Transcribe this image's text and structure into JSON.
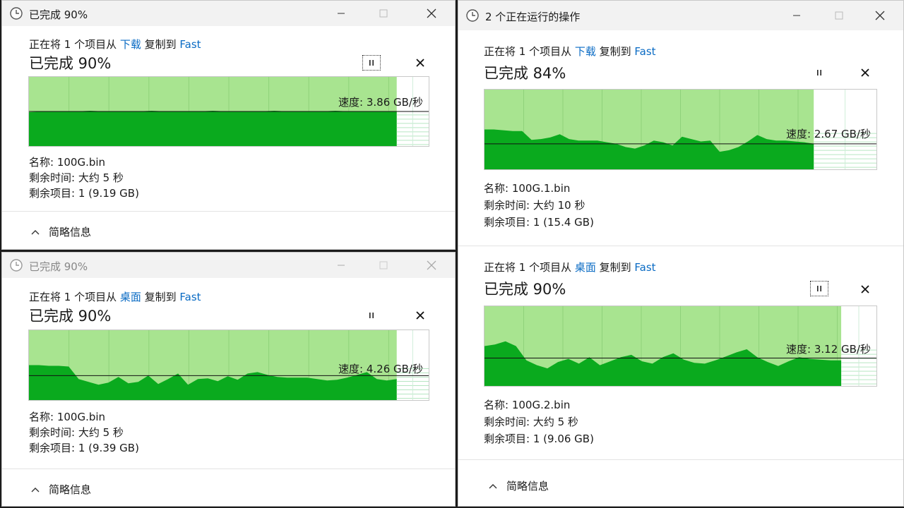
{
  "colors": {
    "graph_fill_light": "#a8e490",
    "graph_fill_dark": "#0aaa1e",
    "link": "#0a6bc4"
  },
  "icons": {
    "clock": "clock-icon",
    "minimize": "minimize-icon",
    "maximize": "maximize-icon",
    "close": "close-icon",
    "pause": "pause-icon",
    "cancel": "cancel-icon",
    "chevron_up": "chevron-up-icon"
  },
  "windows": [
    {
      "title": "已完成 90%",
      "active": true,
      "ops": [
        {
          "line": {
            "prefix": "正在将 1 个项目从 ",
            "source": "下载",
            "middle": " 复制到 ",
            "dest": "Fast"
          },
          "percent_text": "已完成 90%",
          "progress": 0.92,
          "speed_text": "速度: 3.86 GB/秒",
          "speed_level": 0.5,
          "name_label": "名称:",
          "name_value": "100G.bin",
          "time_label": "剩余时间:",
          "time_value": "大约 5 秒",
          "items_label": "剩余项目:",
          "items_value": "1 (9.19 GB)",
          "pause_focused": true,
          "history": [
            0.49,
            0.5,
            0.5,
            0.5,
            0.51,
            0.5,
            0.5,
            0.5,
            0.51,
            0.5,
            0.5,
            0.5,
            0.51,
            0.5,
            0.5,
            0.5,
            0.51,
            0.5,
            0.5,
            0.5,
            0.51,
            0.5,
            0.5,
            0.5,
            0.5
          ]
        }
      ],
      "footer": "简略信息"
    },
    {
      "title": "已完成 90%",
      "active": false,
      "ops": [
        {
          "line": {
            "prefix": "正在将 1 个项目从 ",
            "source": "桌面",
            "middle": " 复制到 ",
            "dest": "Fast"
          },
          "percent_text": "已完成 90%",
          "progress": 0.92,
          "speed_text": "速度: 4.26 GB/秒",
          "speed_level": 0.35,
          "name_label": "名称:",
          "name_value": "100G.bin",
          "time_label": "剩余时间:",
          "time_value": "大约 5 秒",
          "items_label": "剩余项目:",
          "items_value": "1 (9.39 GB)",
          "pause_focused": false,
          "history": [
            0.5,
            0.5,
            0.49,
            0.49,
            0.48,
            0.3,
            0.26,
            0.22,
            0.25,
            0.33,
            0.24,
            0.26,
            0.35,
            0.23,
            0.3,
            0.38,
            0.22,
            0.3,
            0.31,
            0.27,
            0.34,
            0.29,
            0.38,
            0.4,
            0.36,
            0.33,
            0.32,
            0.32,
            0.32,
            0.3,
            0.28,
            0.29,
            0.32,
            0.36,
            0.4,
            0.3,
            0.28,
            0.3
          ]
        }
      ],
      "footer": "简略信息"
    },
    {
      "title": "2 个正在运行的操作",
      "active": true,
      "ops": [
        {
          "line": {
            "prefix": "正在将 1 个项目从 ",
            "source": "下载",
            "middle": " 复制到 ",
            "dest": "Fast"
          },
          "percent_text": "已完成 84%",
          "progress": 0.84,
          "speed_text": "速度: 2.67 GB/秒",
          "speed_level": 0.32,
          "name_label": "名称:",
          "name_value": "100G.1.bin",
          "time_label": "剩余时间:",
          "time_value": "大约 10 秒",
          "items_label": "剩余项目:",
          "items_value": "1 (15.4 GB)",
          "pause_focused": false,
          "history": [
            0.5,
            0.5,
            0.49,
            0.48,
            0.48,
            0.37,
            0.38,
            0.4,
            0.44,
            0.38,
            0.36,
            0.36,
            0.36,
            0.34,
            0.32,
            0.28,
            0.26,
            0.3,
            0.36,
            0.34,
            0.3,
            0.41,
            0.38,
            0.35,
            0.36,
            0.22,
            0.24,
            0.28,
            0.35,
            0.43,
            0.38,
            0.36,
            0.36,
            0.35,
            0.34,
            0.32
          ]
        },
        {
          "line": {
            "prefix": "正在将 1 个项目从 ",
            "source": "桌面",
            "middle": " 复制到 ",
            "dest": "Fast"
          },
          "percent_text": "已完成 90%",
          "progress": 0.91,
          "speed_text": "速度: 3.12 GB/秒",
          "speed_level": 0.35,
          "name_label": "名称:",
          "name_value": "100G.2.bin",
          "time_label": "剩余时间:",
          "time_value": "大约 5 秒",
          "items_label": "剩余项目:",
          "items_value": "1 (9.06 GB)",
          "pause_focused": true,
          "history": [
            0.5,
            0.52,
            0.56,
            0.5,
            0.32,
            0.26,
            0.22,
            0.3,
            0.34,
            0.28,
            0.36,
            0.26,
            0.31,
            0.36,
            0.39,
            0.31,
            0.28,
            0.36,
            0.41,
            0.33,
            0.29,
            0.28,
            0.32,
            0.37,
            0.42,
            0.46,
            0.36,
            0.3,
            0.25,
            0.31,
            0.36,
            0.34,
            0.33,
            0.32,
            0.32
          ]
        }
      ],
      "footer": "简略信息"
    }
  ]
}
